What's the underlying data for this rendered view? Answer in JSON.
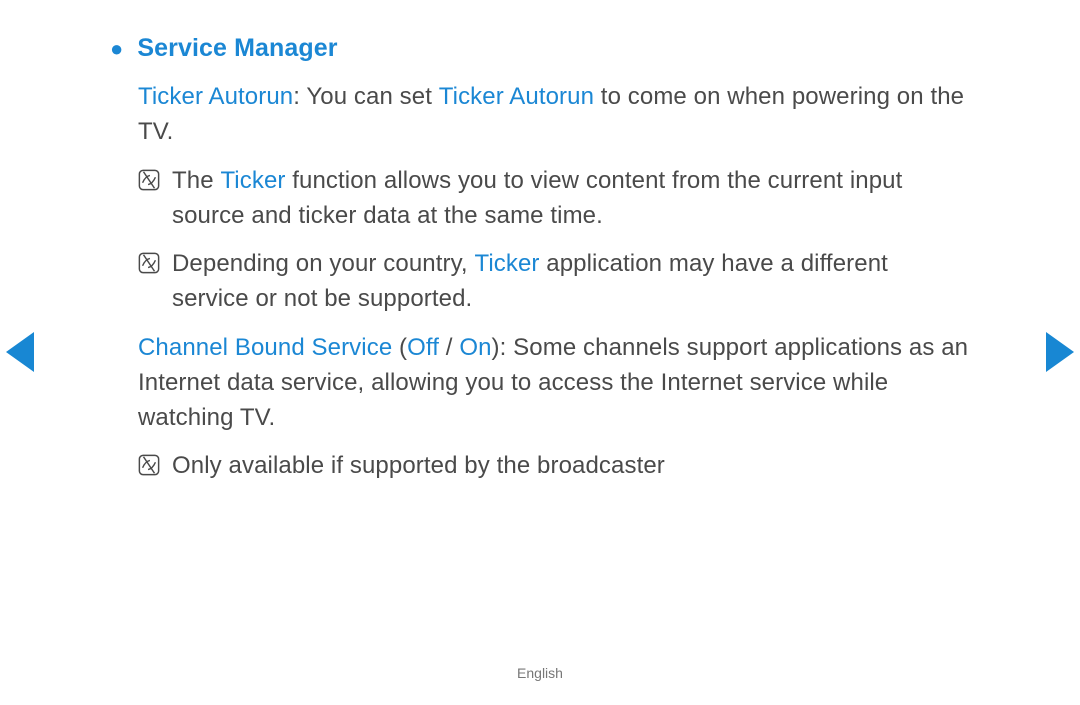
{
  "heading": "Service Manager",
  "para1": {
    "lead": "Ticker Autorun",
    "midA": ": You can set ",
    "bold": "Ticker Autorun",
    "midB": " to come on when powering on the TV."
  },
  "note1": {
    "preA": "The ",
    "bold": "Ticker",
    "postA": " function allows you to view content from the current input source and ticker data at the same time."
  },
  "note2": {
    "preA": "Depending on your country, ",
    "bold": "Ticker",
    "postA": " application may have a different service or not be supported."
  },
  "para2": {
    "lead": "Channel Bound Service",
    "openparen": " (",
    "off": "Off",
    "slash": " / ",
    "on": "On",
    "closeparen": ")",
    "rest": ": Some channels support applications as an Internet data service, allowing you to access the Internet service while watching TV."
  },
  "note3": {
    "text": "Only available if supported by the broadcaster"
  },
  "footer_lang": "English"
}
